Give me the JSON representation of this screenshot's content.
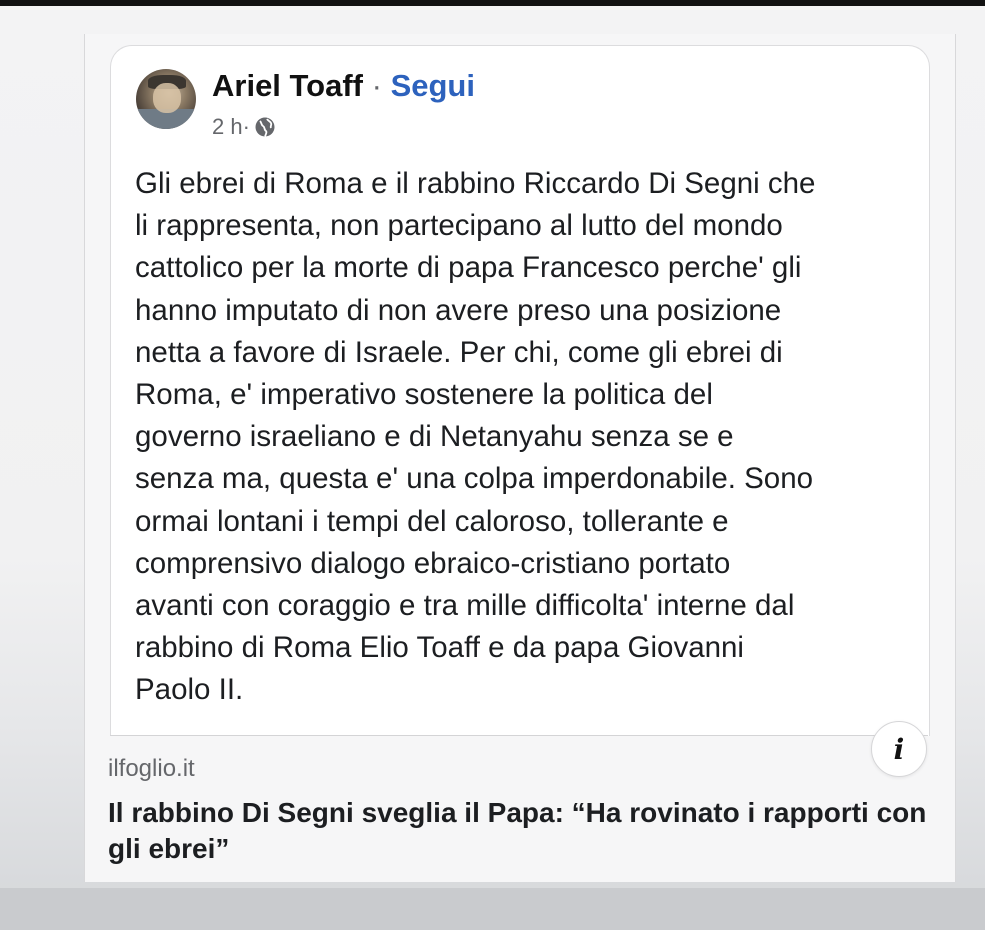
{
  "post": {
    "author": "Ariel Toaff",
    "separator": " · ",
    "follow_label": "Segui",
    "time": "2 h",
    "meta_separator": " · ",
    "audience_icon": "globe-icon",
    "text": "Gli ebrei di Roma e il rabbino Riccardo Di Segni che\nli rappresenta, non partecipano al lutto del mondo\ncattolico per la morte di papa Francesco perche' gli\nhanno imputato di non avere preso una posizione\nnetta a favore di Israele. Per chi, come gli ebrei di\nRoma, e' imperativo sostenere la politica del\ngoverno israeliano e di Netanyahu senza se e\nsenza ma, questa e' una colpa imperdonabile. Sono\normai lontani i tempi del caloroso, tollerante e\ncomprensivo dialogo ebraico-cristiano portato\navanti con coraggio e tra mille difficolta' interne dal\nrabbino  di Roma Elio Toaff e da papa Giovanni\nPaolo II."
  },
  "link_preview": {
    "domain": "ilfoglio.it",
    "title": "Il rabbino Di Segni sveglia il Papa: “Ha rovinato i rapporti con gli ebrei”",
    "info_icon": "info-icon",
    "info_label": "i"
  },
  "colors": {
    "follow": "#2d62bd",
    "meta": "#65676b",
    "text": "#1c1e21"
  }
}
